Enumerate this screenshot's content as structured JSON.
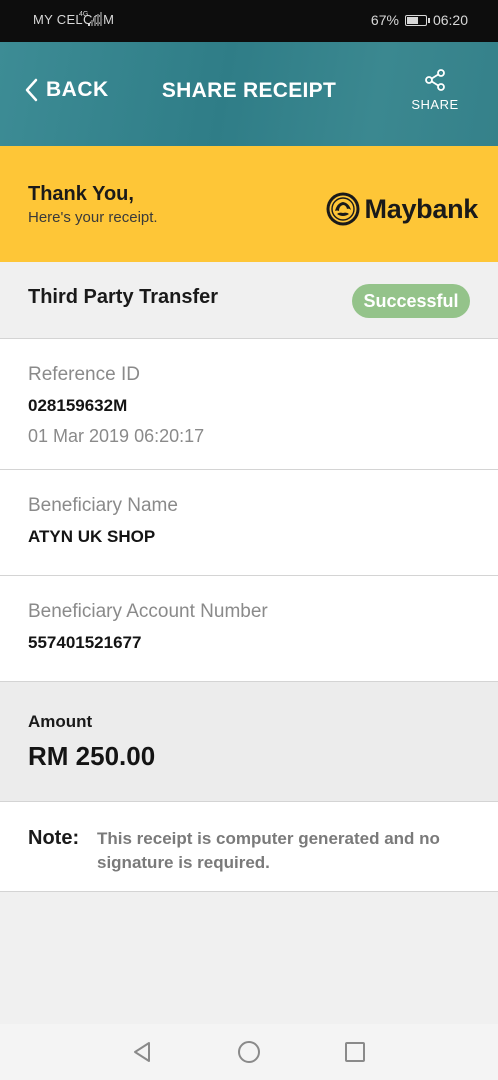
{
  "status_bar": {
    "carrier": "MY CELCOM",
    "network": "4G",
    "battery_percent": "67%",
    "battery_level": 0.67,
    "time": "06:20"
  },
  "header": {
    "back_label": "BACK",
    "title": "SHARE RECEIPT",
    "share_label": "SHARE"
  },
  "banner": {
    "title": "Thank You,",
    "subtitle": "Here's your receipt.",
    "brand": "Maybank"
  },
  "transaction": {
    "type": "Third Party Transfer",
    "status": "Successful",
    "reference_label": "Reference ID",
    "reference_id": "028159632M",
    "datetime": "01 Mar 2019 06:20:17",
    "beneficiary_name_label": "Beneficiary Name",
    "beneficiary_name": "ATYN UK SHOP",
    "beneficiary_account_label": "Beneficiary Account Number",
    "beneficiary_account": "557401521677",
    "amount_label": "Amount",
    "amount": "RM 250.00"
  },
  "note": {
    "label": "Note:",
    "text": "This receipt is computer generated and no signature is required."
  },
  "colors": {
    "header_teal": "#2f7d87",
    "banner_yellow": "#fec637",
    "status_green": "#94c38a"
  },
  "icons": {
    "back": "chevron-left-icon",
    "share": "share-icon",
    "logo": "maybank-tiger-icon",
    "nav_back": "triangle-back-icon",
    "nav_home": "circle-home-icon",
    "nav_recents": "square-recents-icon"
  }
}
